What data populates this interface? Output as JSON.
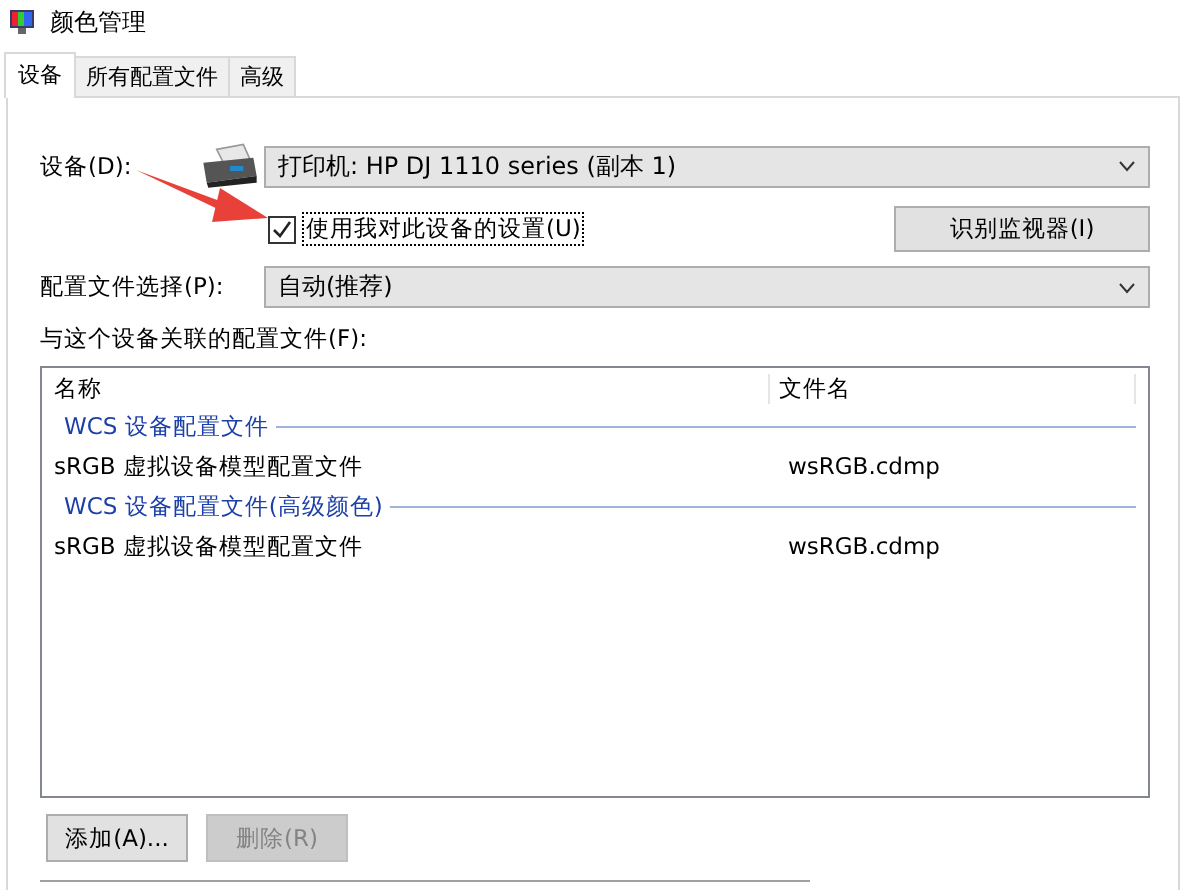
{
  "window": {
    "title": "颜色管理"
  },
  "tabs": [
    {
      "label": "设备",
      "selected": true
    },
    {
      "label": "所有配置文件",
      "selected": false
    },
    {
      "label": "高级",
      "selected": false
    }
  ],
  "device": {
    "label": "设备(D):",
    "value": "打印机: HP DJ 1110 series (副本 1)"
  },
  "use_my_settings": {
    "label": "使用我对此设备的设置(U)",
    "checked": true
  },
  "identify_button": "识别监视器(I)",
  "profile_selection": {
    "label": "配置文件选择(P):",
    "value": "自动(推荐)"
  },
  "profiles": {
    "label": "与这个设备关联的配置文件(F):",
    "columns": [
      "名称",
      "文件名"
    ],
    "groups": [
      {
        "title": "WCS 设备配置文件",
        "rows": [
          {
            "name": "sRGB 虚拟设备模型配置文件",
            "file": "wsRGB.cdmp"
          }
        ]
      },
      {
        "title": "WCS 设备配置文件(高级颜色)",
        "rows": [
          {
            "name": "sRGB 虚拟设备模型配置文件",
            "file": "wsRGB.cdmp"
          }
        ]
      }
    ]
  },
  "buttons": [
    {
      "label": "添加(A)...",
      "disabled": false
    },
    {
      "label": "删除(R)",
      "disabled": true
    }
  ]
}
